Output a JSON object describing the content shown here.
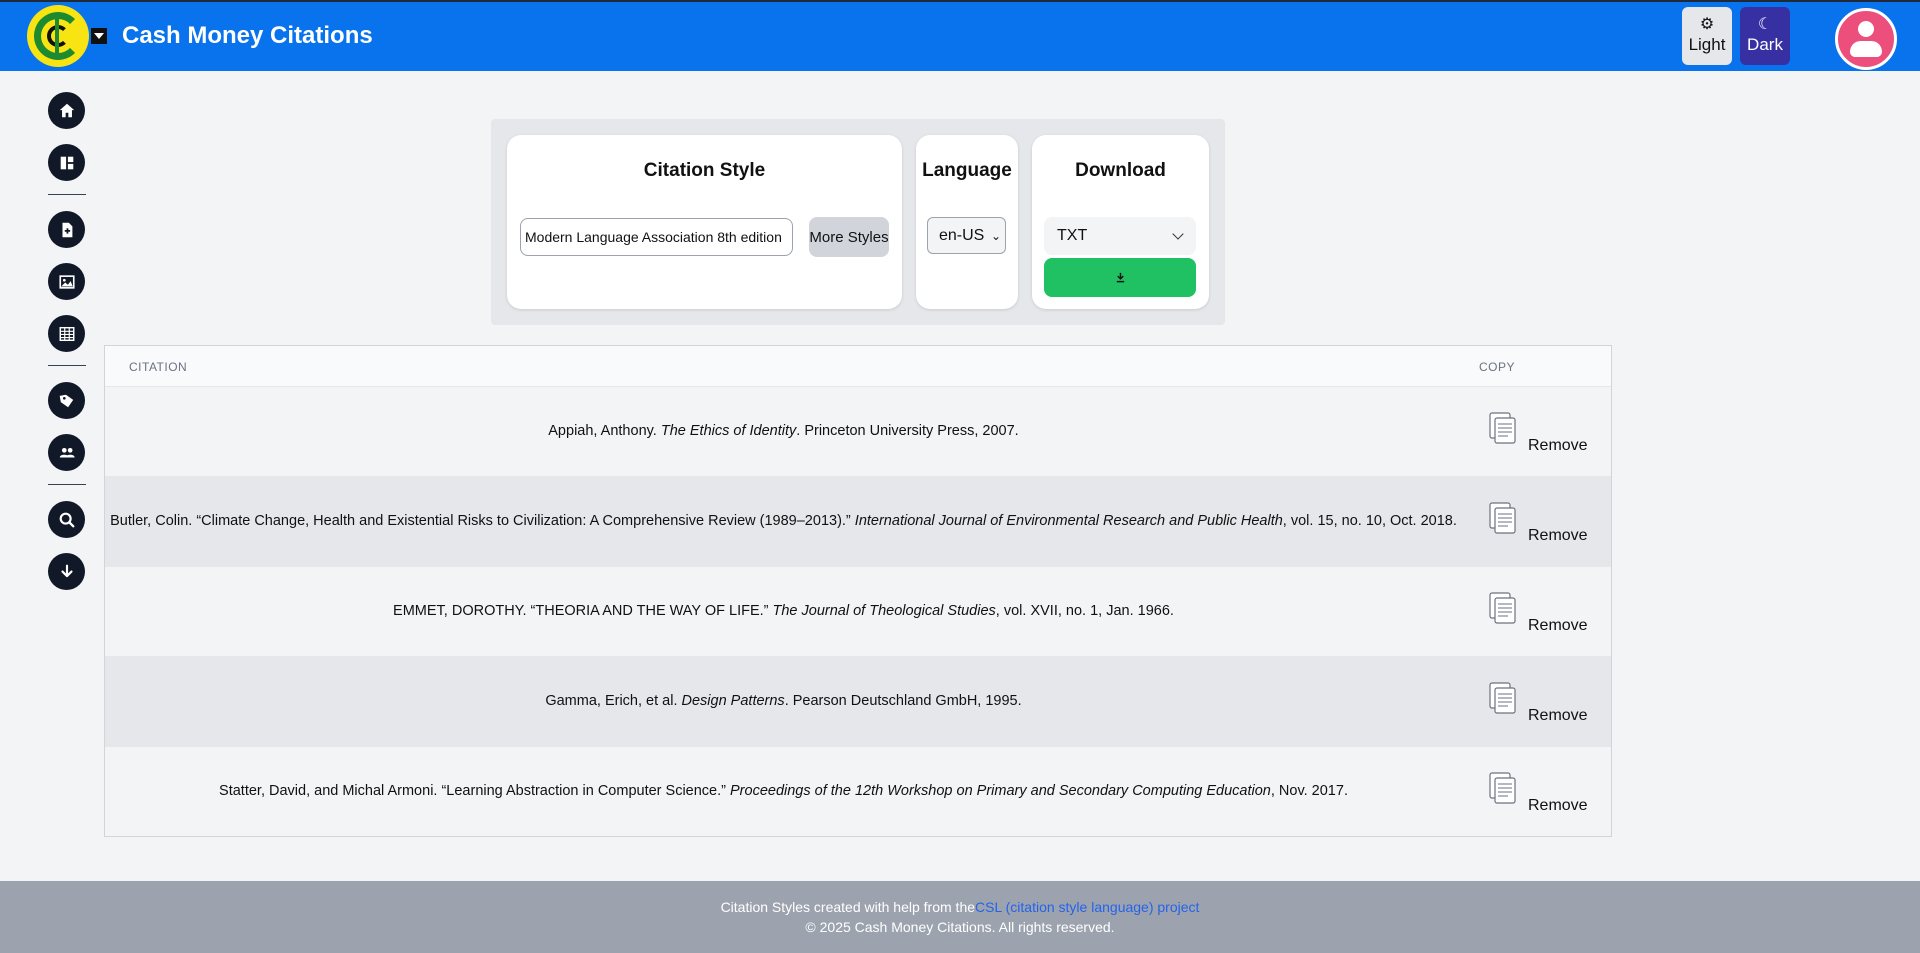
{
  "header": {
    "title": "Cash Money Citations",
    "light_label": "Light",
    "dark_label": "Dark",
    "colors": {
      "bar": "#0873ec",
      "dark_button": "#3730a3",
      "avatar": "#ec4f7c"
    }
  },
  "sidebar": {
    "items": [
      {
        "icon": "home-icon"
      },
      {
        "icon": "dashboard-icon"
      },
      {
        "icon": "add-file-icon"
      },
      {
        "icon": "image-icon"
      },
      {
        "icon": "table-icon"
      },
      {
        "icon": "tags-icon"
      },
      {
        "icon": "users-icon"
      },
      {
        "icon": "search-icon"
      },
      {
        "icon": "download-icon"
      }
    ]
  },
  "toolbar": {
    "style_heading": "Citation Style",
    "style_value": "Modern Language Association 8th edition",
    "more_styles_label": "More Styles",
    "language_heading": "Language",
    "language_value": "en-US",
    "download_heading": "Download",
    "format_value": "TXT",
    "download_color": "#1fc163"
  },
  "table": {
    "headers": {
      "citation": "CITATION",
      "copy": "COPY"
    },
    "remove_label": "Remove",
    "rows": [
      {
        "pre": "Appiah, Anthony. ",
        "italic": "The Ethics of Identity",
        "post": ". Princeton University Press, 2007."
      },
      {
        "pre": "Butler, Colin. “Climate Change, Health and Existential Risks to Civilization: A Comprehensive Review (1989–2013).” ",
        "italic": "International Journal of Environmental Research and Public Health",
        "post": ", vol. 15, no. 10, Oct. 2018."
      },
      {
        "pre": "EMMET, DOROTHY. “THEORIA AND THE WAY OF LIFE.” ",
        "italic": "The Journal of Theological Studies",
        "post": ", vol. XVII, no. 1, Jan. 1966."
      },
      {
        "pre": "Gamma, Erich, et al. ",
        "italic": "Design Patterns",
        "post": ". Pearson Deutschland GmbH, 1995."
      },
      {
        "pre": "Statter, David, and Michal Armoni. “Learning Abstraction in Computer Science.” ",
        "italic": "Proceedings of the 12th Workshop on Primary and Secondary Computing Education",
        "post": ", Nov. 2017."
      }
    ]
  },
  "footer": {
    "credit_prefix": "Citation Styles created with help from the",
    "credit_link": "CSL (citation style language) project",
    "copyright": "© 2025 Cash Money Citations. All rights reserved."
  }
}
